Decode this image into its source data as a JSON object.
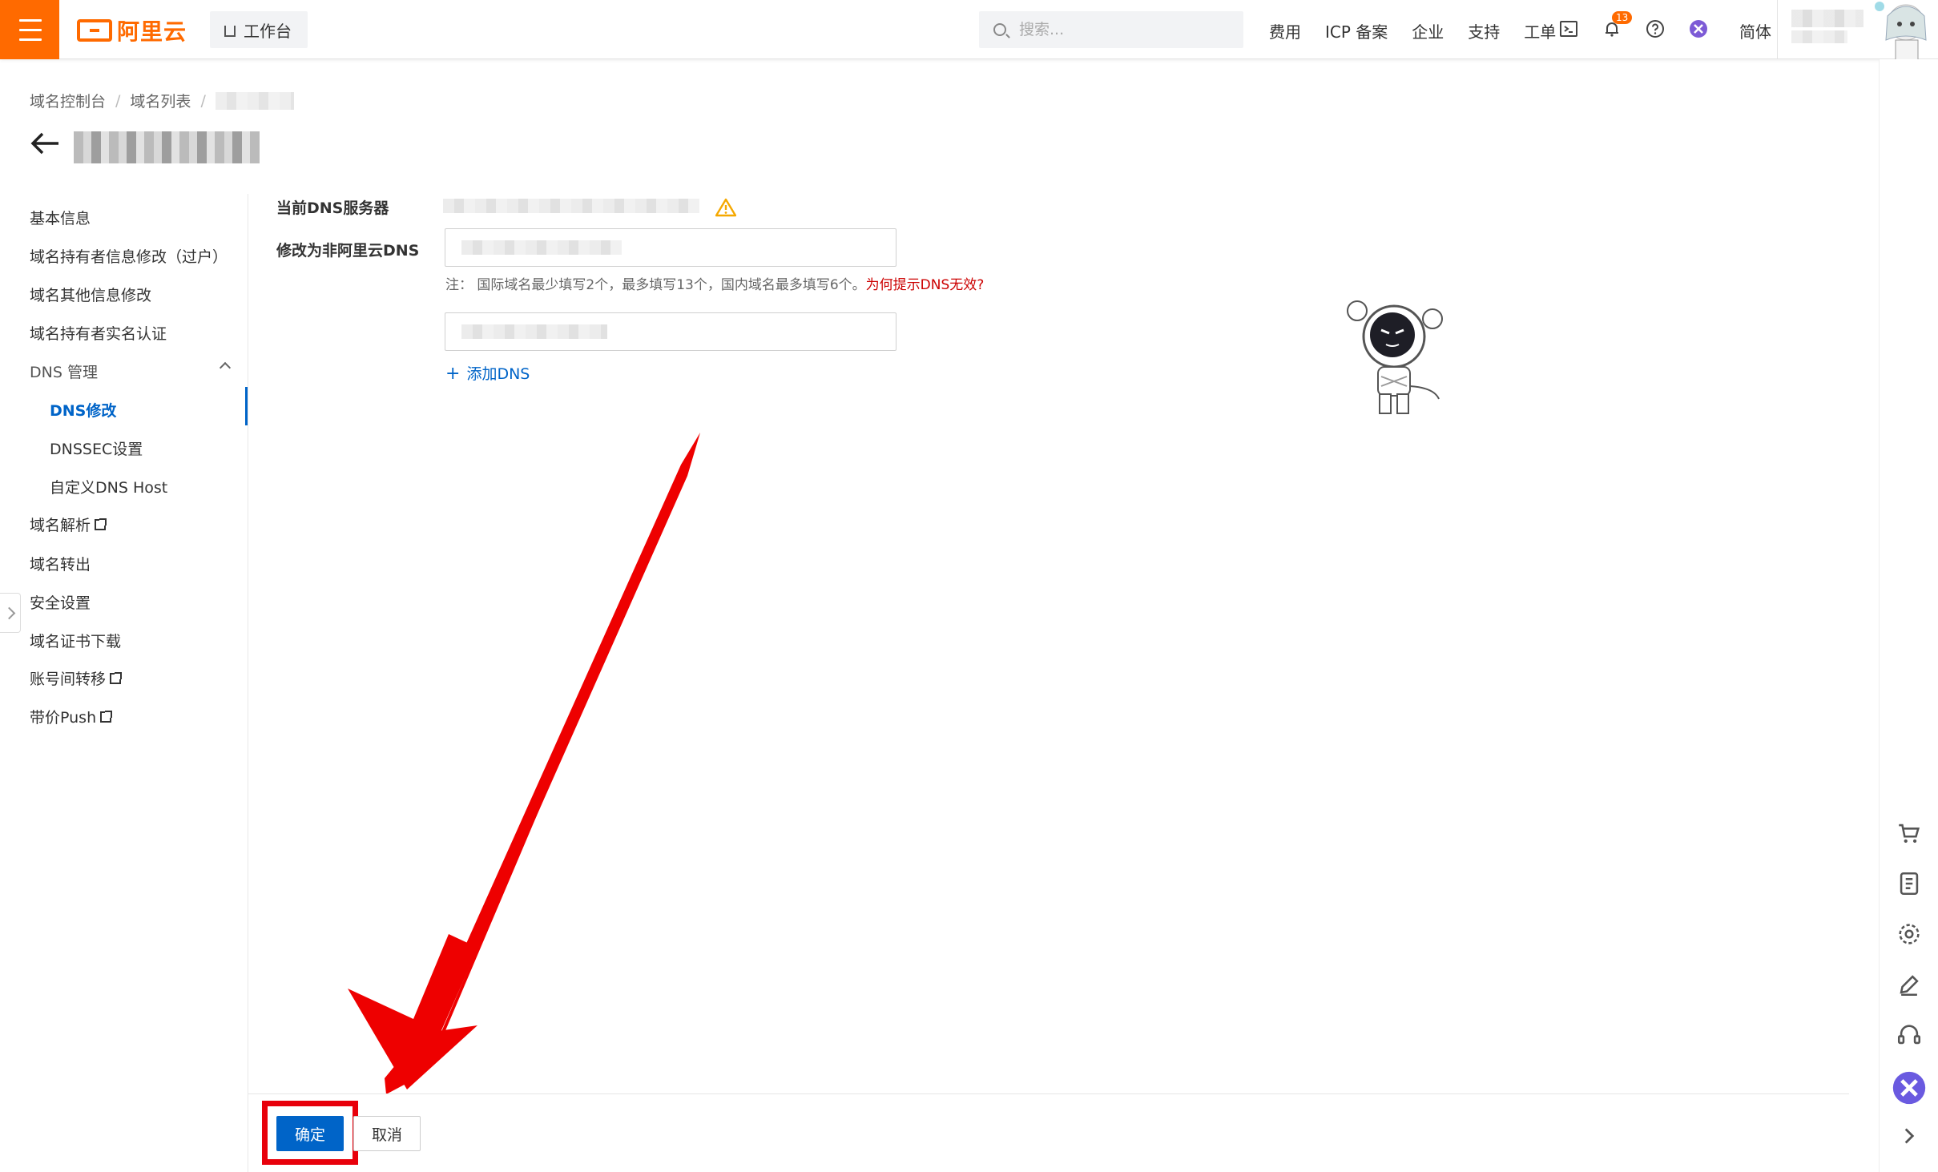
{
  "topbar": {
    "logo_text": "阿里云",
    "workbench_label": "工作台",
    "search_placeholder": "搜索...",
    "nav_links": [
      "费用",
      "ICP 备案",
      "企业",
      "支持",
      "工单"
    ],
    "notification_count": "13",
    "language": "简体",
    "brand_color": "#ff6a00"
  },
  "breadcrumb": {
    "items": [
      "域名控制台",
      "域名列表"
    ]
  },
  "sidebar": {
    "items": [
      {
        "label": "基本信息"
      },
      {
        "label": "域名持有者信息修改（过户）"
      },
      {
        "label": "域名其他信息修改"
      },
      {
        "label": "域名持有者实名认证"
      },
      {
        "label": "DNS 管理"
      },
      {
        "label": "DNS修改"
      },
      {
        "label": "DNSSEC设置"
      },
      {
        "label": "自定义DNS Host"
      },
      {
        "label": "域名解析"
      },
      {
        "label": "域名转出"
      },
      {
        "label": "安全设置"
      },
      {
        "label": "域名证书下载"
      },
      {
        "label": "账号间转移"
      },
      {
        "label": "带价Push"
      }
    ],
    "active_item": "DNS修改",
    "accent_color": "#0064c8"
  },
  "form": {
    "current_dns_label": "当前DNS服务器",
    "change_dns_label": "修改为非阿里云DNS",
    "note_text": "注：  国际域名最少填写2个，最多填写13个，国内域名最多填写6个。",
    "note_link": "为何提示DNS无效?",
    "add_dns_label": "添加DNS"
  },
  "footer": {
    "confirm_label": "确定",
    "cancel_label": "取消"
  },
  "right_rail": {
    "icons": [
      "cart-icon",
      "document-icon",
      "settings-icon",
      "edit-icon",
      "headset-icon",
      "close-circle-icon",
      "chevron-right-icon"
    ]
  }
}
